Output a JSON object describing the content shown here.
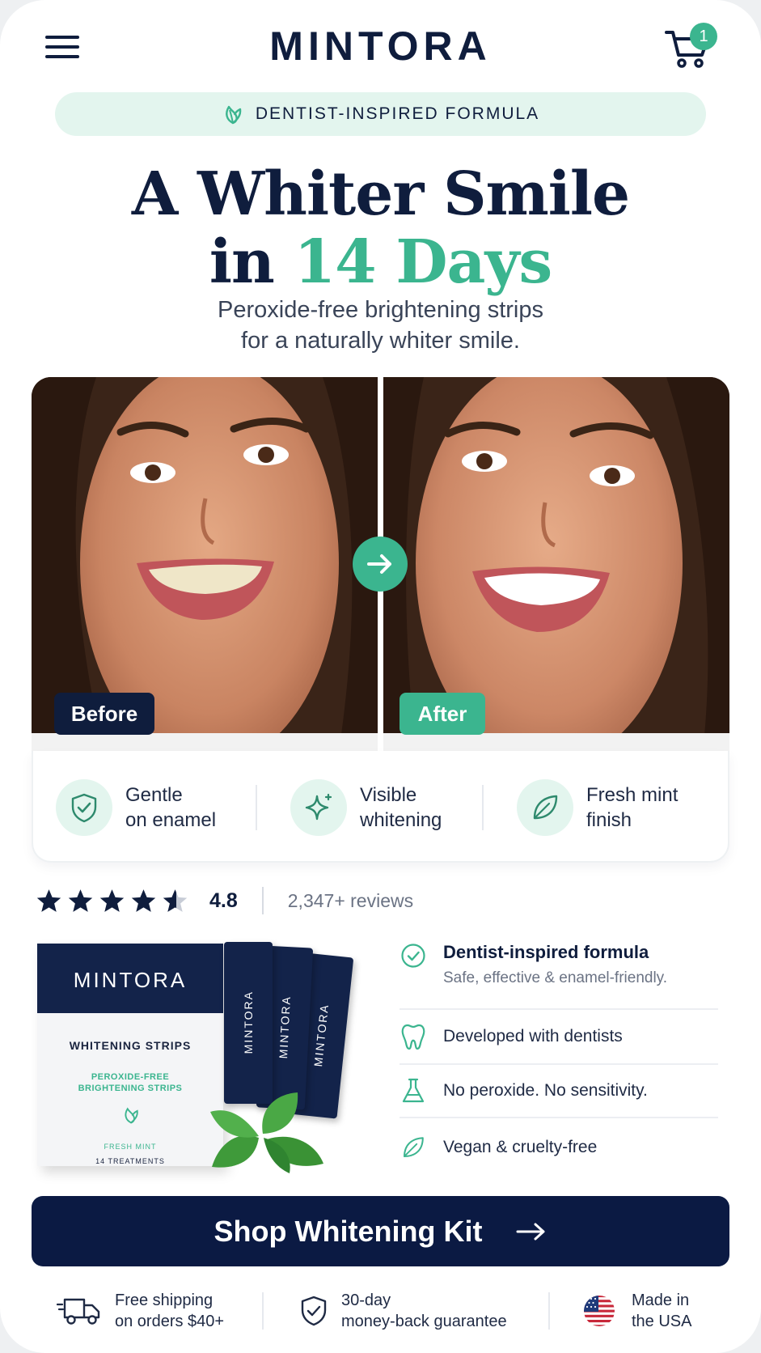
{
  "header": {
    "brand": "MINTORA",
    "cart_count": "1"
  },
  "badge": {
    "label": "DENTIST-INSPIRED FORMULA",
    "icon": "leaf-icon"
  },
  "hero": {
    "headline_line1": "A Whiter Smile",
    "headline_line2_prefix": "in ",
    "headline_line2_accent": "14 Days",
    "subhead_line1": "Peroxide-free brightening strips",
    "subhead_line2": "for a naturally whiter smile."
  },
  "comparison": {
    "before_label": "Before",
    "after_label": "After"
  },
  "benefits": [
    {
      "line1": "Gentle",
      "line2": "on enamel",
      "icon": "shield-check-icon"
    },
    {
      "line1": "Visible",
      "line2": "whitening",
      "icon": "sparkle-icon"
    },
    {
      "line1": "Fresh mint",
      "line2": "finish",
      "icon": "leaf-icon"
    }
  ],
  "rating": {
    "stars": 4.8,
    "score": "4.8",
    "reviews": "2,347+ reviews"
  },
  "product_box": {
    "brand": "MINTORA",
    "title": "WHITENING STRIPS",
    "subtitle_line1": "PEROXIDE-FREE",
    "subtitle_line2": "BRIGHTENING STRIPS",
    "flavor": "FRESH MINT",
    "treatments": "14 TREATMENTS",
    "strip_label": "MINTORA"
  },
  "features": {
    "primary_title": "Dentist-inspired formula",
    "primary_sub": "Safe, effective & enamel-friendly.",
    "item1": "Developed with dentists",
    "item2": "No peroxide. No sensitivity.",
    "item3": "Vegan & cruelty-free"
  },
  "cta": {
    "label": "Shop Whitening Kit"
  },
  "trust": {
    "shipping_line1": "Free shipping",
    "shipping_line2": "on orders $40+",
    "guarantee_line1": "30-day",
    "guarantee_line2": "money-back guarantee",
    "origin_line1": "Made in",
    "origin_line2": "the USA"
  },
  "colors": {
    "navy": "#0f1d3d",
    "mint": "#3bb58f",
    "mint_light": "#e3f5ee",
    "cta": "#0b1a43"
  }
}
